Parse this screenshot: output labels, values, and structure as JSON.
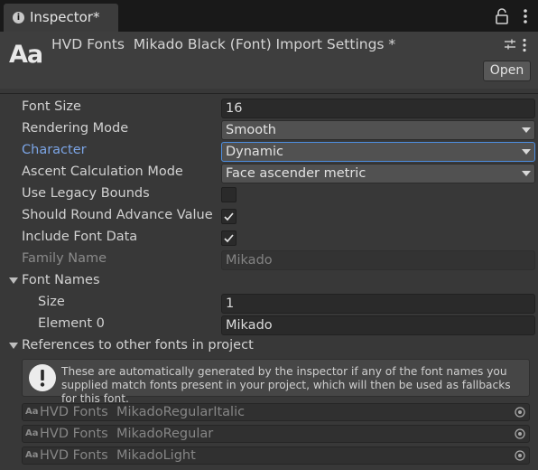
{
  "window": {
    "tab_label": "Inspector*",
    "tab_icon": "info-icon",
    "header_icon_text": "Aa",
    "title": "HVD Fonts  Mikado Black (Font) Import Settings *",
    "open_label": "Open"
  },
  "properties": {
    "font_size": {
      "label": "Font Size",
      "value": "16"
    },
    "rendering_mode": {
      "label": "Rendering Mode",
      "value": "Smooth"
    },
    "character": {
      "label": "Character",
      "value": "Dynamic"
    },
    "ascent_mode": {
      "label": "Ascent Calculation Mode",
      "value": "Face ascender metric"
    },
    "legacy_bounds": {
      "label": "Use Legacy Bounds",
      "checked": false
    },
    "round_advance": {
      "label": "Should Round Advance Value",
      "checked": true
    },
    "include_font_data": {
      "label": "Include Font Data",
      "checked": true
    },
    "family_name": {
      "label": "Family Name",
      "value": "Mikado"
    }
  },
  "font_names": {
    "label": "Font Names",
    "size_label": "Size",
    "size_value": "1",
    "element0_label": "Element 0",
    "element0_value": "Mikado"
  },
  "references": {
    "label": "References to other fonts in project",
    "help_text": "These are automatically generated by the inspector if any of the font names you supplied match fonts present in your project, which will then be used as fallbacks for this font.",
    "object_icon_text": "Aa",
    "fonts": [
      "HVD Fonts  MikadoRegularItalic",
      "HVD Fonts  MikadoRegular",
      "HVD Fonts  MikadoLight"
    ]
  },
  "colors": {
    "accent_focus": "#4d8ee0",
    "label_highlight": "#7ca5e6"
  }
}
